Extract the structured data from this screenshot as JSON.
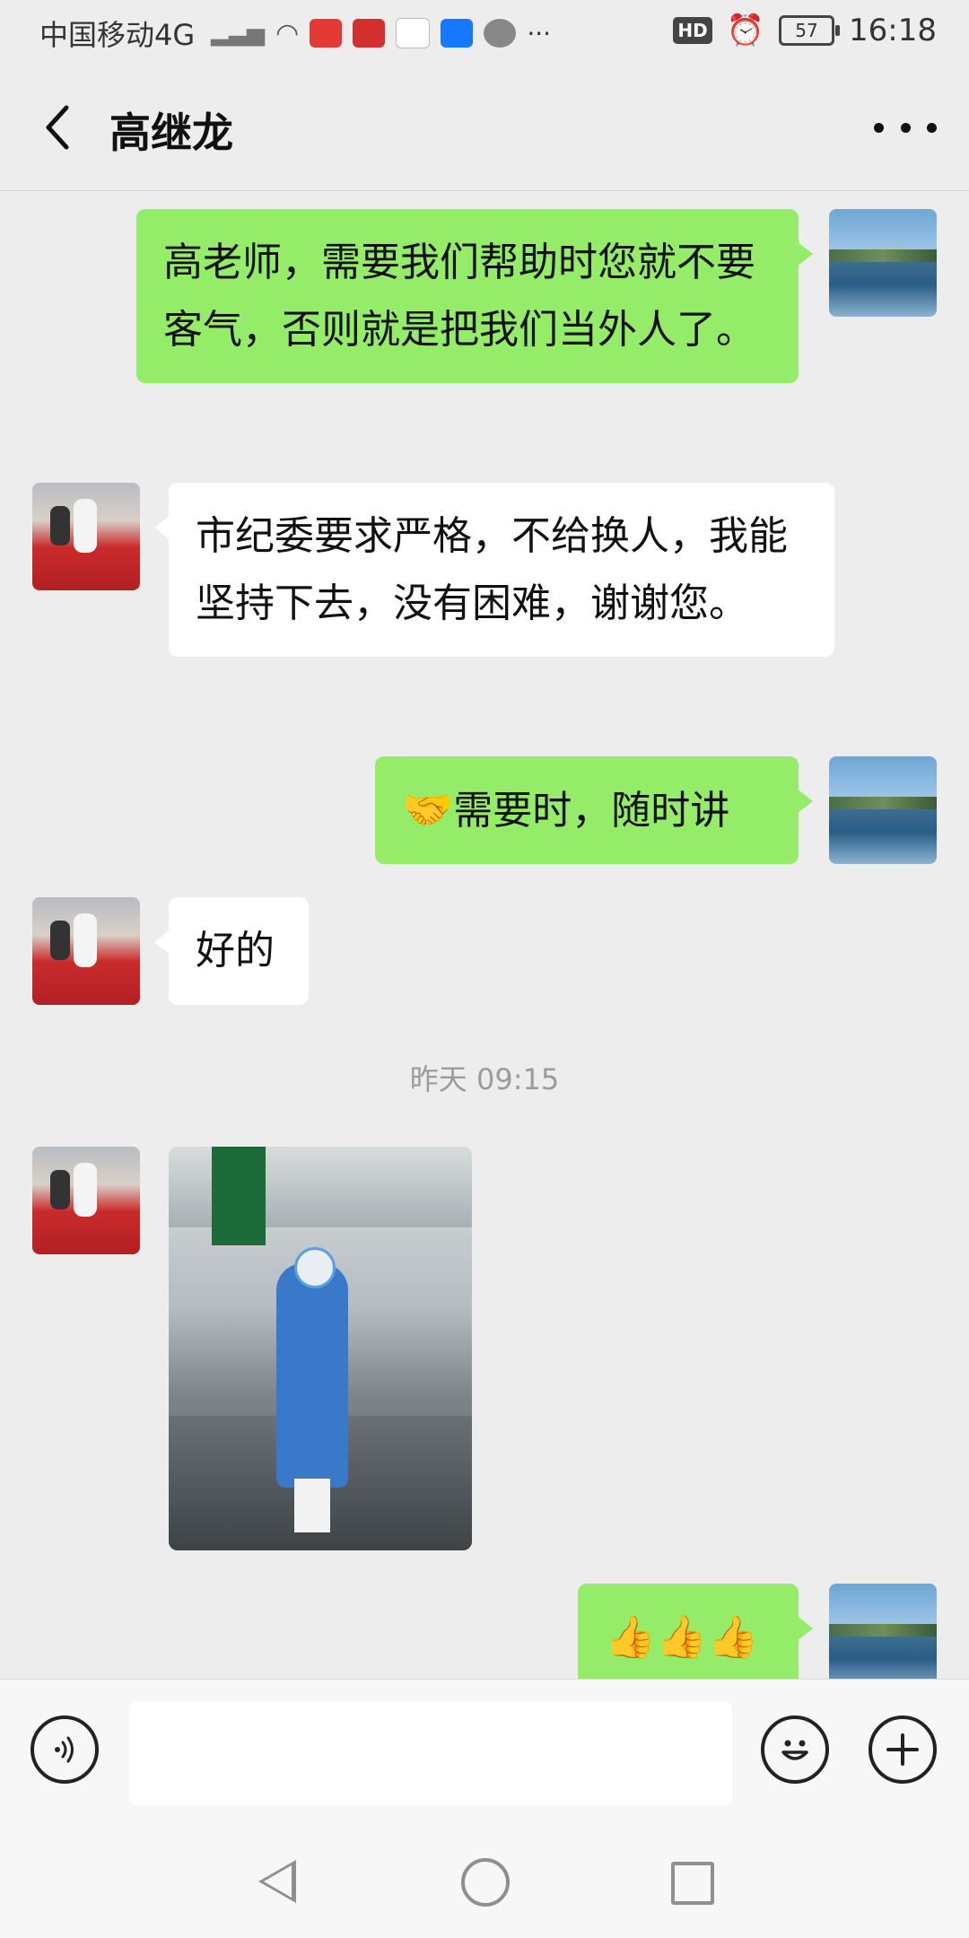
{
  "status_bar": {
    "carrier": "中国移动4G",
    "network": "4G",
    "hd": "HD",
    "battery": "57",
    "time": "16:18",
    "more": "···"
  },
  "header": {
    "back_icon": "chevron-left-icon",
    "contact_name": "高继龙",
    "more_icon": "more-dots-icon"
  },
  "messages": [
    {
      "from": "me",
      "text": "高老师，需要我们帮助时您就不要客气，否则就是把我们当外人了。"
    },
    {
      "from": "other",
      "text": "市纪委要求严格，不给换人，我能坚持下去，没有困难，谢谢您。"
    },
    {
      "from": "me",
      "emoji": "🤝",
      "text": "需要时，随时讲"
    },
    {
      "from": "other",
      "text": "好的"
    },
    {
      "timestamp": "昨天 09:15"
    },
    {
      "from": "other",
      "type": "image"
    },
    {
      "from": "me",
      "text": "👍👍👍"
    }
  ],
  "input_bar": {
    "voice_icon": "voice-icon",
    "input_value": "",
    "emoji_icon": "smiley-icon",
    "plus_icon": "plus-icon"
  },
  "nav_bar": {
    "icons": [
      "nav-back-icon",
      "nav-home-icon",
      "nav-recent-icon"
    ]
  },
  "colors": {
    "background": "#ededed",
    "my_bubble": "#95ec69",
    "other_bubble": "#ffffff",
    "timestamp": "#9b9b9b"
  }
}
